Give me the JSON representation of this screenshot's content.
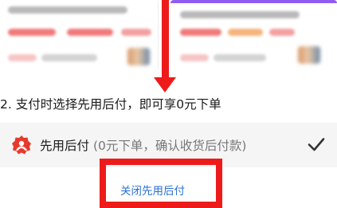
{
  "step": {
    "text": "2. 支付时选择先用后付，即可享0元下单"
  },
  "option": {
    "icon": "pay-later-logo-icon",
    "title": "先用后付",
    "description": "(0元下单，确认收货后付款)",
    "selected_icon": "checkmark-icon",
    "selected": true
  },
  "close_link": {
    "label": "关闭先用后付"
  },
  "annotation": {
    "arrow_icon": "red-arrow-down-icon",
    "highlight_color": "#ee1b1b"
  },
  "colors": {
    "link": "#2c6fd6",
    "row_background": "#f5f5f5",
    "banner": "#8e5cf0"
  }
}
